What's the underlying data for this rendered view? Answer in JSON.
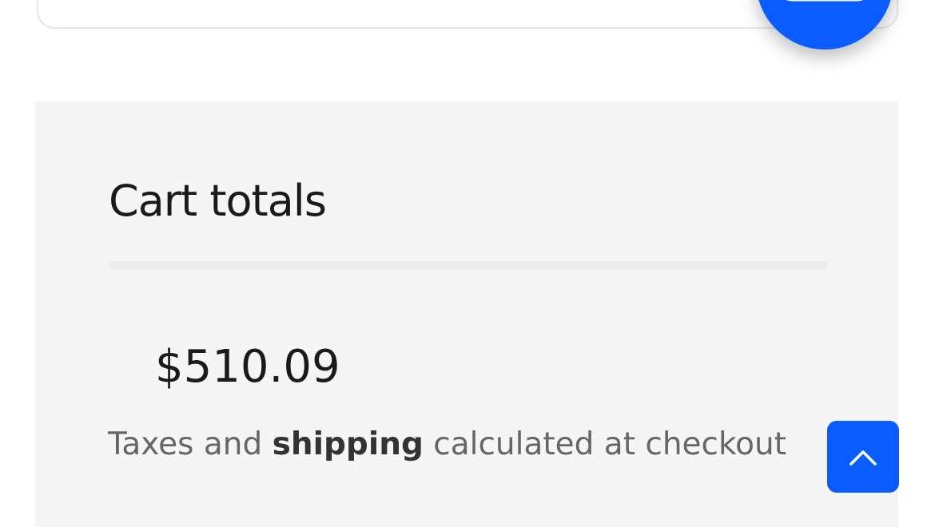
{
  "cart_totals": {
    "title": "Cart totals",
    "total": "$510.09",
    "note_before": "Taxes and",
    "note_bold": "shipping",
    "note_after": "calculated at checkout"
  },
  "floating_button": {
    "icon": "cart-icon",
    "color": "#0a5cff"
  },
  "back_to_top": {
    "icon": "chevron-up-icon",
    "color": "#0a5cff"
  }
}
